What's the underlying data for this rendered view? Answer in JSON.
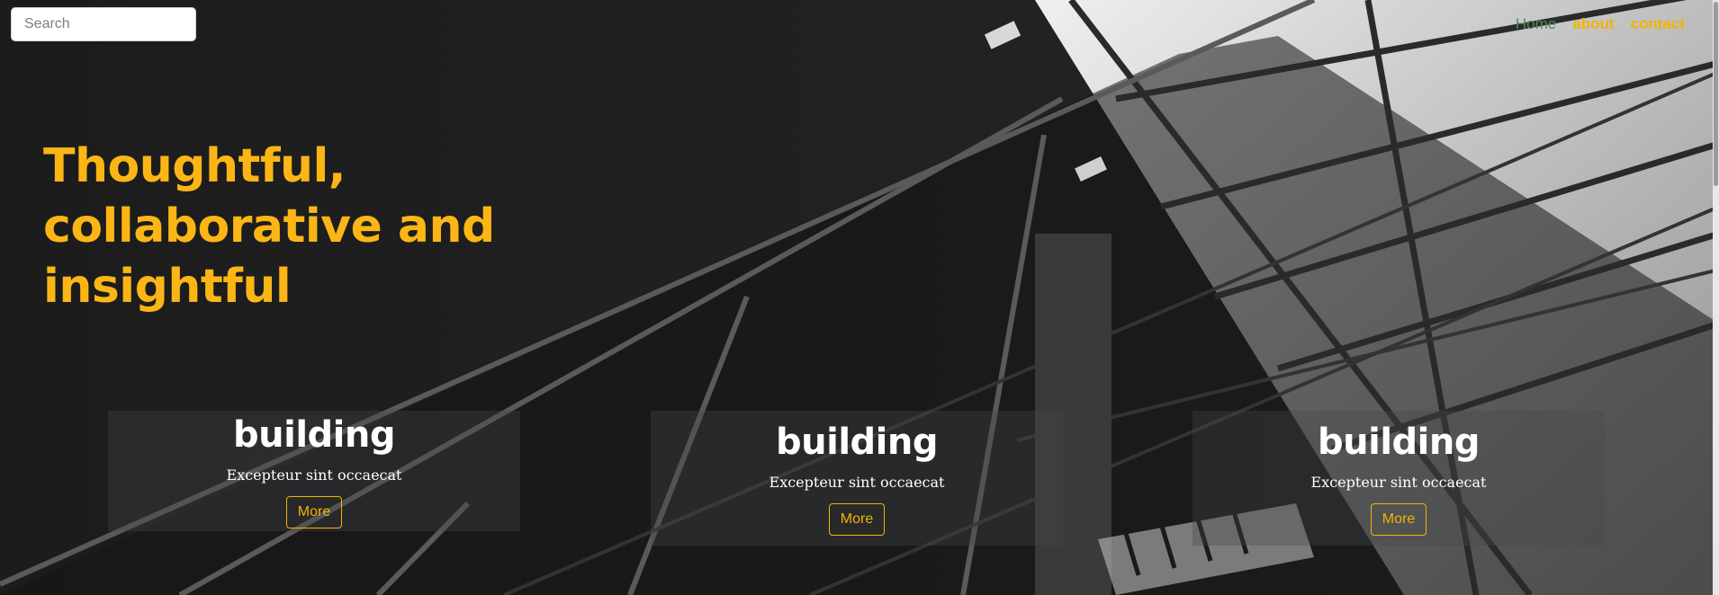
{
  "search": {
    "placeholder": "Search"
  },
  "nav": {
    "items": [
      {
        "label": "Home",
        "color": "#4f8a5e"
      },
      {
        "label": "about",
        "color": "#f2b400"
      },
      {
        "label": "contact",
        "color": "#f2b400"
      }
    ]
  },
  "hero": {
    "title": "Thoughtful, collaborative and insightful",
    "color": "#fbb616"
  },
  "cards": [
    {
      "title": "building",
      "text": "Excepteur sint occaecat",
      "button": "More"
    },
    {
      "title": "building",
      "text": "Excepteur sint occaecat",
      "button": "More"
    },
    {
      "title": "building",
      "text": "Excepteur sint occaecat",
      "button": "More"
    }
  ],
  "colors": {
    "accent": "#f2b400",
    "background": "#1d1d1f"
  }
}
